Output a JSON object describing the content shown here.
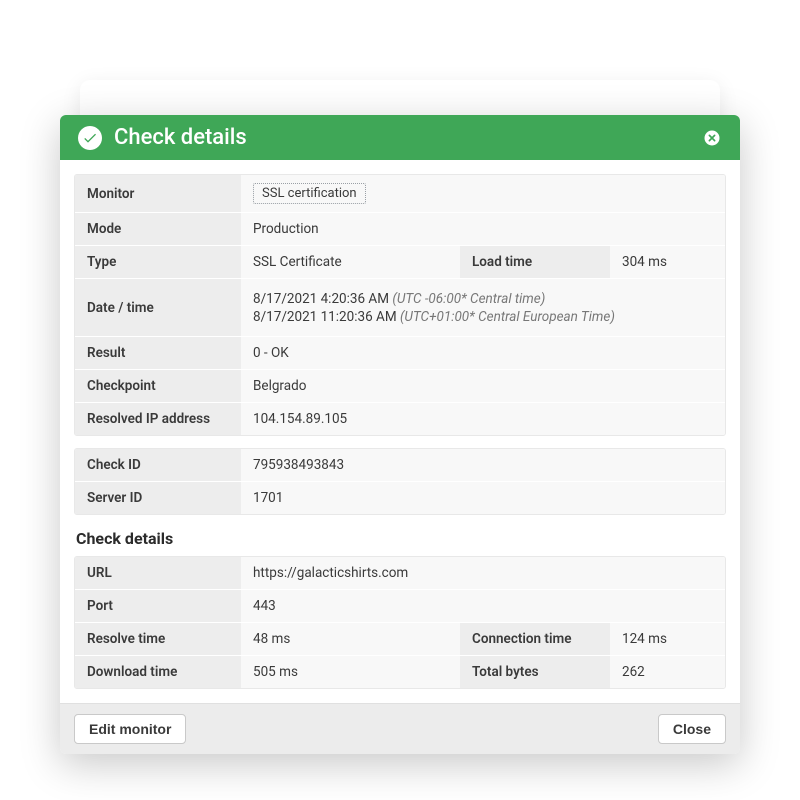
{
  "header": {
    "title": "Check details"
  },
  "block1": {
    "monitor_label": "Monitor",
    "monitor_value": "SSL certification",
    "mode_label": "Mode",
    "mode_value": "Production",
    "type_label": "Type",
    "type_value": "SSL Certificate",
    "loadtime_label": "Load time",
    "loadtime_value": "304 ms",
    "datetime_label": "Date / time",
    "datetime_1_main": "8/17/2021 4:20:36 AM ",
    "datetime_1_tz": "(UTC -06:00* Central time)",
    "datetime_2_main": "8/17/2021 11:20:36 AM ",
    "datetime_2_tz": "(UTC+01:00* Central European Time)",
    "result_label": "Result",
    "result_value": "0 - OK",
    "checkpoint_label": "Checkpoint",
    "checkpoint_value": "Belgrado",
    "resolvedip_label": "Resolved IP address",
    "resolvedip_value": "104.154.89.105"
  },
  "block2": {
    "checkid_label": "Check ID",
    "checkid_value": "795938493843",
    "serverid_label": "Server ID",
    "serverid_value": "1701"
  },
  "section_title": "Check details",
  "block3": {
    "url_label": "URL",
    "url_value": "https://galacticshirts.com",
    "port_label": "Port",
    "port_value": "443",
    "resolve_label": "Resolve time",
    "resolve_value": "48 ms",
    "connection_label": "Connection time",
    "connection_value": "124 ms",
    "download_label": "Download time",
    "download_value": "505 ms",
    "totalbytes_label": "Total bytes",
    "totalbytes_value": "262"
  },
  "footer": {
    "edit_label": "Edit monitor",
    "close_label": "Close"
  }
}
